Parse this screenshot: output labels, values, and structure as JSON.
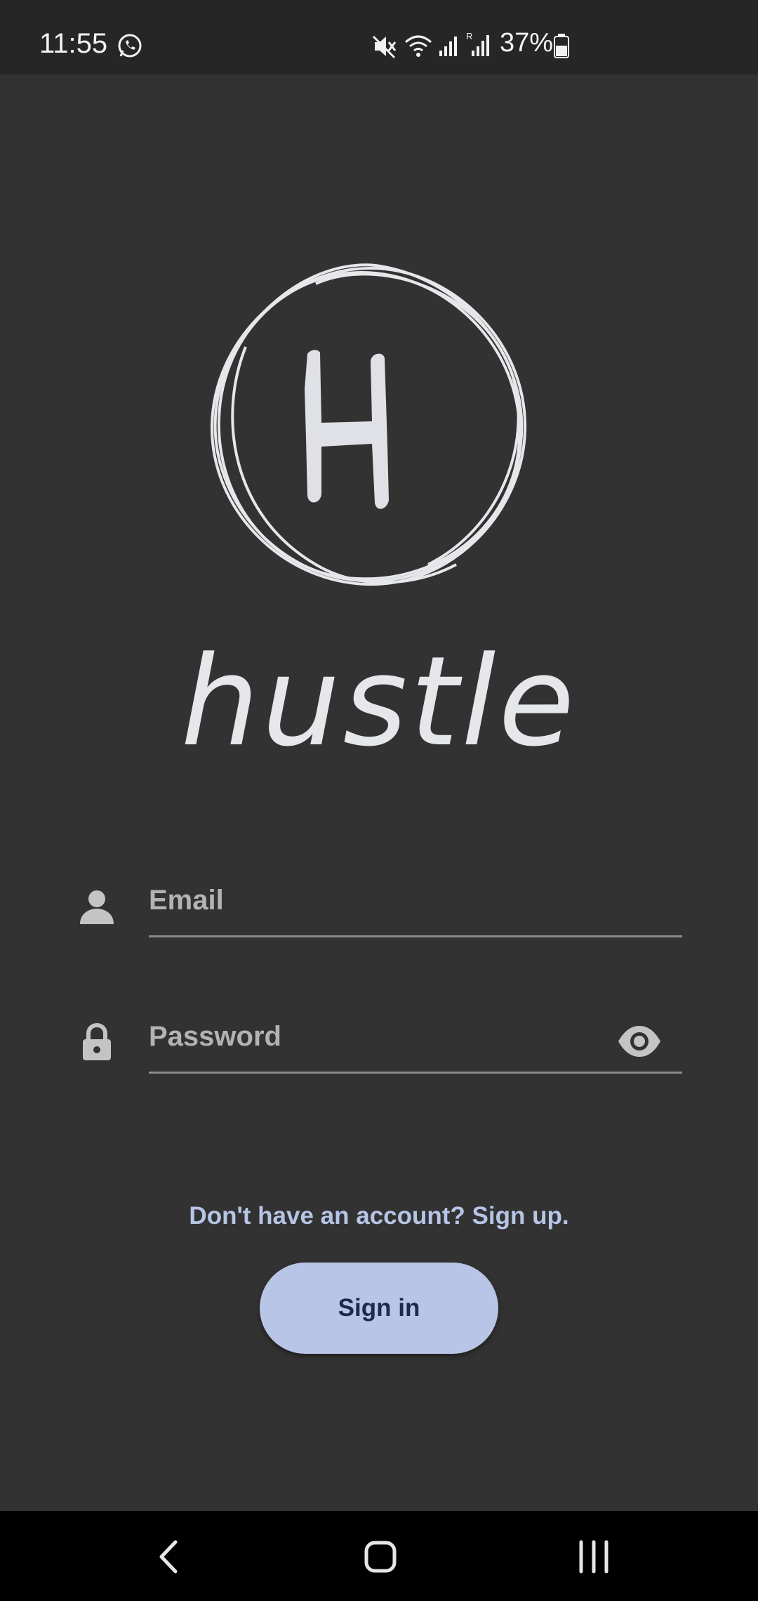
{
  "status_bar": {
    "time": "11:55",
    "battery": "37%",
    "icons": [
      "whatsapp-icon",
      "mute-icon",
      "wifi-icon",
      "signal-icon",
      "signal-roaming-icon",
      "battery-icon"
    ]
  },
  "app": {
    "name": "hustle",
    "logo_letter": "H"
  },
  "login": {
    "email_placeholder": "Email",
    "email_value": "",
    "password_placeholder": "Password",
    "password_value": "",
    "signup_text": "Don't have an account? Sign up.",
    "signin_label": "Sign in"
  },
  "nav_bar": {
    "icons": [
      "back-icon",
      "home-icon",
      "recents-icon"
    ]
  },
  "colors": {
    "background": "#323232",
    "status_bar": "#262626",
    "accent": "#b9c5e6",
    "link": "#b6c4e6",
    "button_text": "#1e2a4a"
  }
}
